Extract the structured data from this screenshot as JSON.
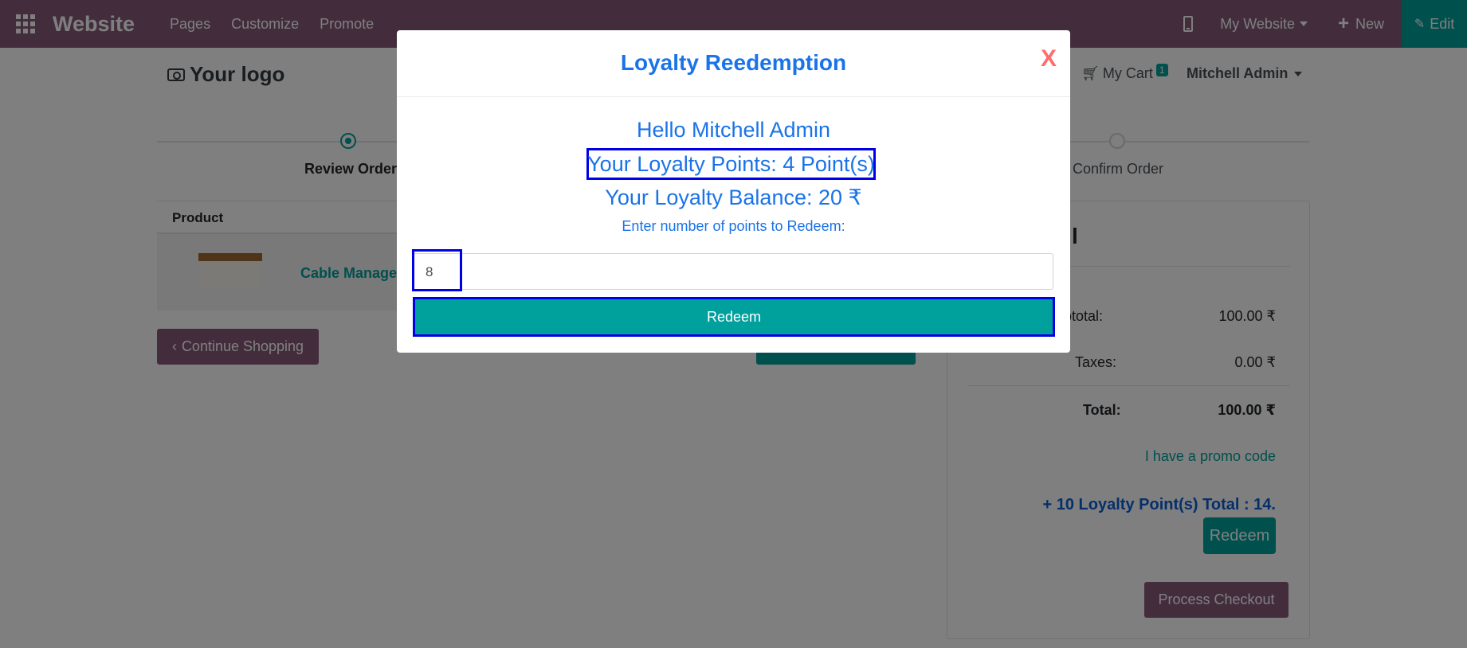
{
  "navbar": {
    "brand": "Website",
    "menu": [
      "Pages",
      "Customize",
      "Promote"
    ],
    "my_website": "My Website",
    "new_label": "New",
    "edit_label": "Edit",
    "colors": {
      "bar": "#875a7b",
      "edit": "#00a09d"
    }
  },
  "header": {
    "logo_text": "Your logo",
    "cart_label": "My Cart",
    "cart_count": "1",
    "user": "Mitchell Admin"
  },
  "wizard": {
    "step_review": "Review Order",
    "step_confirm": "Confirm Order"
  },
  "products": {
    "column_header": "Product",
    "rows": [
      {
        "name": "Cable Manager"
      }
    ]
  },
  "continue_shopping": "Continue Shopping",
  "summary": {
    "title": "l",
    "subtotal_label": "ubtotal:",
    "subtotal_value": "100.00 ₹",
    "taxes_label": "Taxes:",
    "taxes_value": "0.00 ₹",
    "total_label": "Total:",
    "total_value": "100.00 ₹",
    "promo_link": "I have a promo code",
    "loyalty_text": "+ 10 Loyalty Point(s) Total : 14.",
    "redeem_label": "Redeem",
    "process_checkout": "Process Checkout"
  },
  "modal": {
    "title": "Loyalty Reedemption",
    "close": "X",
    "greeting": "Hello Mitchell Admin",
    "points_text": "Your Loyalty Points: 4 Point(s)",
    "balance_text": "Your Loyalty Balance: 20 ₹",
    "prompt": "Enter number of points to Redeem:",
    "input_value": "8",
    "redeem_button": "Redeem",
    "colors": {
      "text": "#1a73e8",
      "close": "#ff6e6e",
      "highlight": "#0000e6"
    }
  }
}
